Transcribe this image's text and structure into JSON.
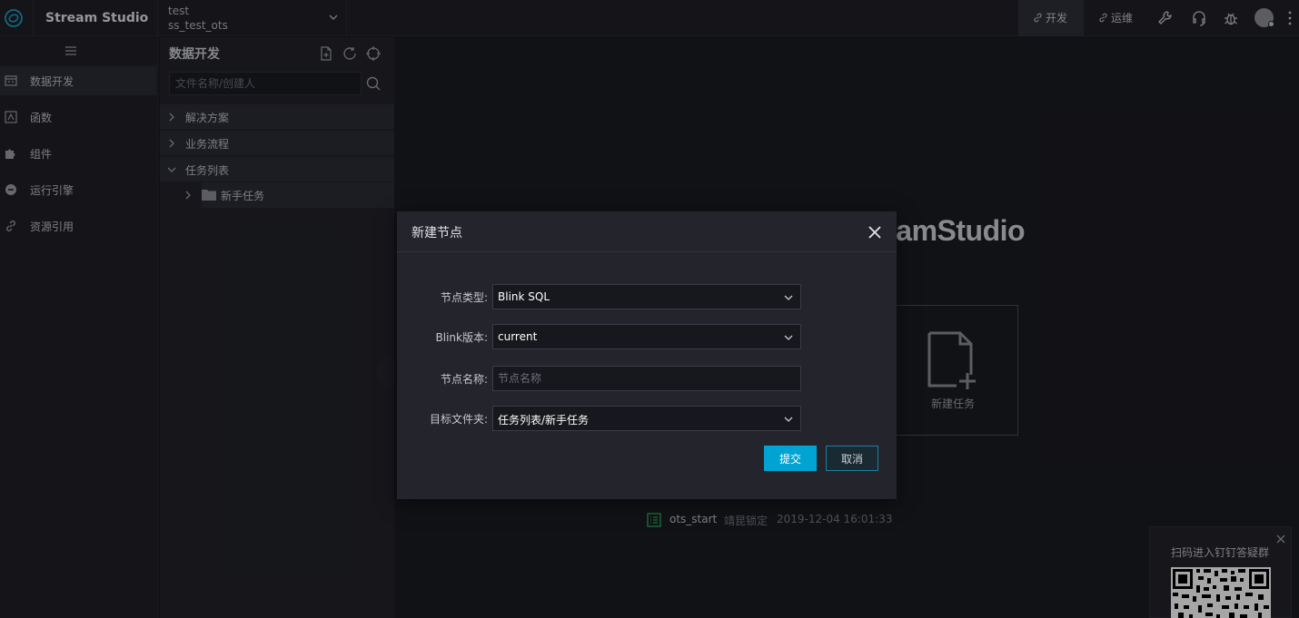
{
  "app": {
    "brand": "Stream Studio"
  },
  "project": {
    "workspace": "test",
    "name": "ss_test_ots"
  },
  "topnav": {
    "dev_label": "开发",
    "ops_label": "运维"
  },
  "leftnav": {
    "items": [
      {
        "label": "数据开发",
        "icon": "data-dev-icon"
      },
      {
        "label": "函数",
        "icon": "function-icon"
      },
      {
        "label": "组件",
        "icon": "puzzle-icon"
      },
      {
        "label": "运行引擎",
        "icon": "engine-icon"
      },
      {
        "label": "资源引用",
        "icon": "link-icon"
      }
    ]
  },
  "filepanel": {
    "title": "数据开发",
    "search_placeholder": "文件名称/创建人",
    "tree": [
      {
        "label": "解决方案",
        "expanded": false
      },
      {
        "label": "业务流程",
        "expanded": false
      },
      {
        "label": "任务列表",
        "expanded": true
      }
    ],
    "child": {
      "label": "新手任务"
    }
  },
  "main": {
    "welcome_title": "eamStudio",
    "new_task_label": "新建任务",
    "recent": {
      "name": "ots_start",
      "lock": "靖昆锁定",
      "time": "2019-12-04 16:01:33"
    }
  },
  "qr": {
    "title": "扫码进入钉钉答疑群"
  },
  "modal": {
    "title": "新建节点",
    "fields": {
      "node_type": {
        "label": "节点类型:",
        "value": "Blink SQL"
      },
      "blink_version": {
        "label": "Blink版本:",
        "value": "current"
      },
      "node_name": {
        "label": "节点名称:",
        "placeholder": "节点名称"
      },
      "target_folder": {
        "label": "目标文件夹:",
        "value": "任务列表/新手任务"
      }
    },
    "submit_label": "提交",
    "cancel_label": "取消"
  },
  "colors": {
    "accent": "#00a3d1",
    "background": "#1b1c22",
    "panel": "#22232a"
  }
}
